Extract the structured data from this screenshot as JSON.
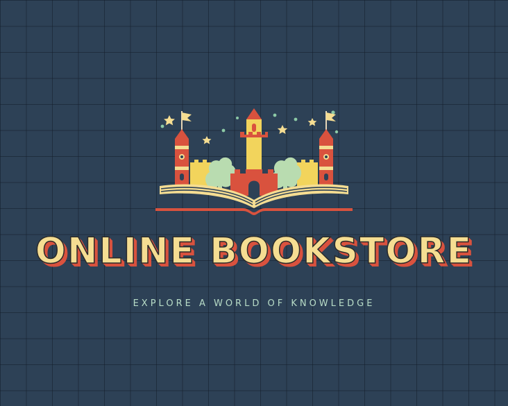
{
  "title": "ONLINE BOOKSTORE",
  "tagline": "EXPLORE A WORLD OF KNOWLEDGE",
  "colors": {
    "background": "#2d4156",
    "grid": "#1c2938",
    "cream": "#f5dd92",
    "red": "#d9523e",
    "yellow": "#f2d45c",
    "green": "#b9dcb0",
    "teal": "#8cc9a6",
    "outline": "#2a2a2a"
  },
  "icons": {
    "emblem": "castle-on-open-book-icon"
  }
}
